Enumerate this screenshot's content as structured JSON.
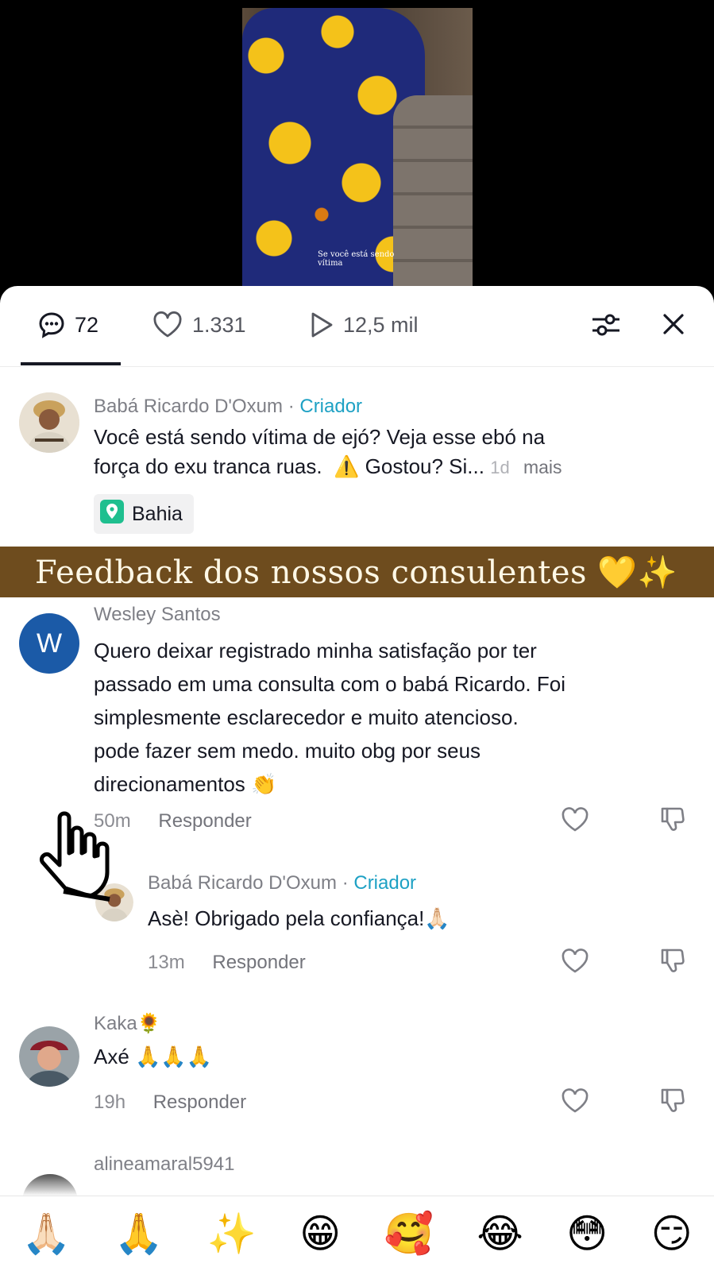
{
  "video": {
    "caption": "Se você está sendo vítima"
  },
  "stats": {
    "comments": "72",
    "likes": "1.331",
    "views": "12,5 mil"
  },
  "post": {
    "author": "Babá Ricardo D'Oxum",
    "separator": "·",
    "creator_badge": "Criador",
    "text_line1": "Você está sendo vítima de ejó? Veja esse ebó na",
    "text_line2": "força do exu tranca ruas.",
    "warning_emoji": "⚠️",
    "text_line2b": "Gostou? Si...",
    "time": "1d",
    "more": "mais",
    "location": "Bahia"
  },
  "banner": {
    "text": "Feedback dos nossos consulentes 💛✨"
  },
  "comments": [
    {
      "author": "Wesley Santos",
      "avatar_letter": "W",
      "lines": [
        "Quero deixar registrado minha satisfação por ter",
        "passado em uma consulta com o babá Ricardo. Foi",
        "simplesmente esclarecedor e muito atencioso.",
        "pode fazer sem medo. muito obg por seus",
        "direcionamentos 👏"
      ],
      "time": "50m",
      "reply": "Responder"
    },
    {
      "author": "Babá Ricardo D'Oxum",
      "creator_badge": "Criador",
      "text": "Asè! Obrigado pela confiança!🙏🏻",
      "time": "13m",
      "reply": "Responder"
    },
    {
      "author": "Kaka🌻",
      "text": "Axé 🙏🙏🙏",
      "time": "19h",
      "reply": "Responder"
    },
    {
      "author": "alineamaral5941"
    }
  ],
  "emoji_bar": [
    "🙏🏻",
    "🙏",
    "✨",
    "😁",
    "🥰",
    "😂",
    "😳",
    "😏"
  ],
  "colors": {
    "creator": "#1ea1c4",
    "banner": "#6e4c1e",
    "wesley_avatar": "#1b5aa7"
  }
}
